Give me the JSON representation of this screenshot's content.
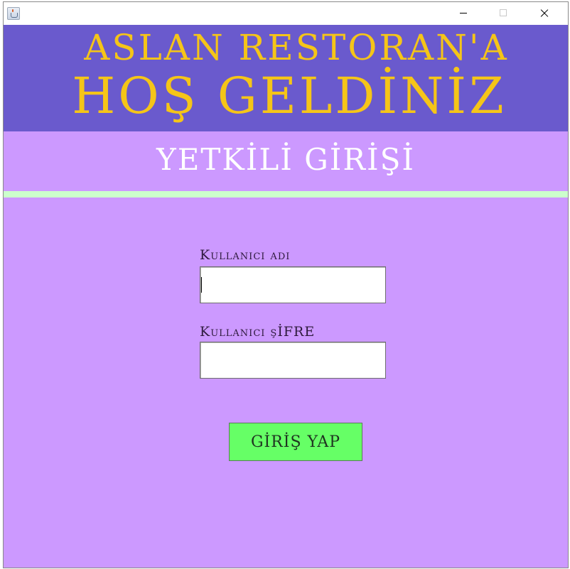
{
  "window": {
    "controls": {
      "minimize_icon": "minimize-icon",
      "maximize_icon": "maximize-icon",
      "close_icon": "close-icon"
    },
    "app_icon": "java-app-icon"
  },
  "header": {
    "line1": "ASLAN RESTORAN'A",
    "line2": "HOŞ GELDİNİZ",
    "background": "#6a5acd",
    "text_color": "#f5c518"
  },
  "subheader": {
    "title": "YETKİLİ GİRİŞİ",
    "background": "#cc99ff",
    "text_color": "#ffffff"
  },
  "form": {
    "username_label": "Kullanıcı adı",
    "username_value": "",
    "password_label": "Kullanıcı şİFRE",
    "password_value": "",
    "login_button": "GİRİŞ YAP",
    "button_color": "#66ff66",
    "divider_color": "#ccffcc"
  }
}
